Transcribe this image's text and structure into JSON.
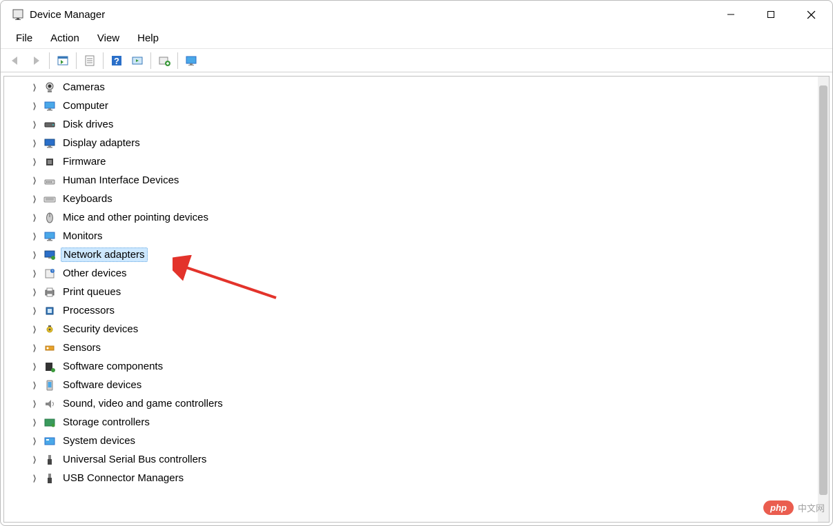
{
  "title": "Device Manager",
  "menubar": [
    "File",
    "Action",
    "View",
    "Help"
  ],
  "toolbar": [
    {
      "name": "back-icon",
      "enabled": false
    },
    {
      "name": "forward-icon",
      "enabled": false
    },
    {
      "sep": true
    },
    {
      "name": "show-hidden-icon",
      "enabled": true
    },
    {
      "sep": true
    },
    {
      "name": "properties-icon",
      "enabled": true
    },
    {
      "sep": true
    },
    {
      "name": "help-icon",
      "enabled": true
    },
    {
      "name": "scan-hardware-icon",
      "enabled": true
    },
    {
      "sep": true
    },
    {
      "name": "add-driver-icon",
      "enabled": true
    },
    {
      "sep": true
    },
    {
      "name": "monitor-icon",
      "enabled": true
    }
  ],
  "tree": [
    {
      "label": "Cameras",
      "icon": "camera-icon",
      "selected": false
    },
    {
      "label": "Computer",
      "icon": "computer-icon",
      "selected": false
    },
    {
      "label": "Disk drives",
      "icon": "disk-icon",
      "selected": false
    },
    {
      "label": "Display adapters",
      "icon": "display-icon",
      "selected": false
    },
    {
      "label": "Firmware",
      "icon": "firmware-icon",
      "selected": false
    },
    {
      "label": "Human Interface Devices",
      "icon": "hid-icon",
      "selected": false
    },
    {
      "label": "Keyboards",
      "icon": "keyboard-icon",
      "selected": false
    },
    {
      "label": "Mice and other pointing devices",
      "icon": "mouse-icon",
      "selected": false
    },
    {
      "label": "Monitors",
      "icon": "monitor-icon",
      "selected": false
    },
    {
      "label": "Network adapters",
      "icon": "network-icon",
      "selected": true
    },
    {
      "label": "Other devices",
      "icon": "other-icon",
      "selected": false
    },
    {
      "label": "Print queues",
      "icon": "printer-icon",
      "selected": false
    },
    {
      "label": "Processors",
      "icon": "cpu-icon",
      "selected": false
    },
    {
      "label": "Security devices",
      "icon": "security-icon",
      "selected": false
    },
    {
      "label": "Sensors",
      "icon": "sensor-icon",
      "selected": false
    },
    {
      "label": "Software components",
      "icon": "software-comp-icon",
      "selected": false
    },
    {
      "label": "Software devices",
      "icon": "software-dev-icon",
      "selected": false
    },
    {
      "label": "Sound, video and game controllers",
      "icon": "sound-icon",
      "selected": false
    },
    {
      "label": "Storage controllers",
      "icon": "storage-icon",
      "selected": false
    },
    {
      "label": "System devices",
      "icon": "system-icon",
      "selected": false
    },
    {
      "label": "Universal Serial Bus controllers",
      "icon": "usb-icon",
      "selected": false
    },
    {
      "label": "USB Connector Managers",
      "icon": "usb-conn-icon",
      "selected": false
    }
  ],
  "scrollbar": {
    "thumb_top_pct": 2,
    "thumb_height_pct": 92
  },
  "watermark": {
    "bubble": "php",
    "text": "中文网"
  }
}
